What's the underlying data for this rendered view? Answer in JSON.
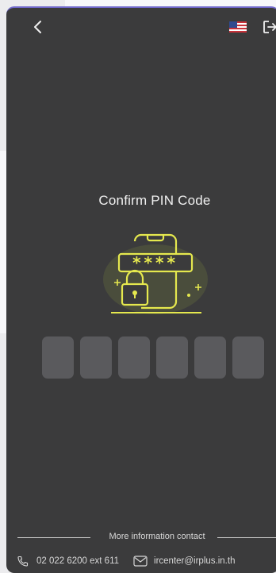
{
  "header": {
    "back_icon": "chevron-left-icon",
    "language_flag": "us-flag-icon",
    "logout_icon": "logout-icon"
  },
  "main": {
    "title": "Confirm PIN Code",
    "illustration": "phone-lock-pin-illustration",
    "pin_masked_text": "****",
    "pin_box_count": 6
  },
  "footer": {
    "divider_label": "More information contact",
    "phone": "02 022 6200 ext 611",
    "email": "ircenter@irplus.in.th"
  },
  "colors": {
    "background": "#3b3b3c",
    "accent": "#e5e84e",
    "pin_box": "#5a5a5d",
    "text": "#f0f0f0"
  }
}
